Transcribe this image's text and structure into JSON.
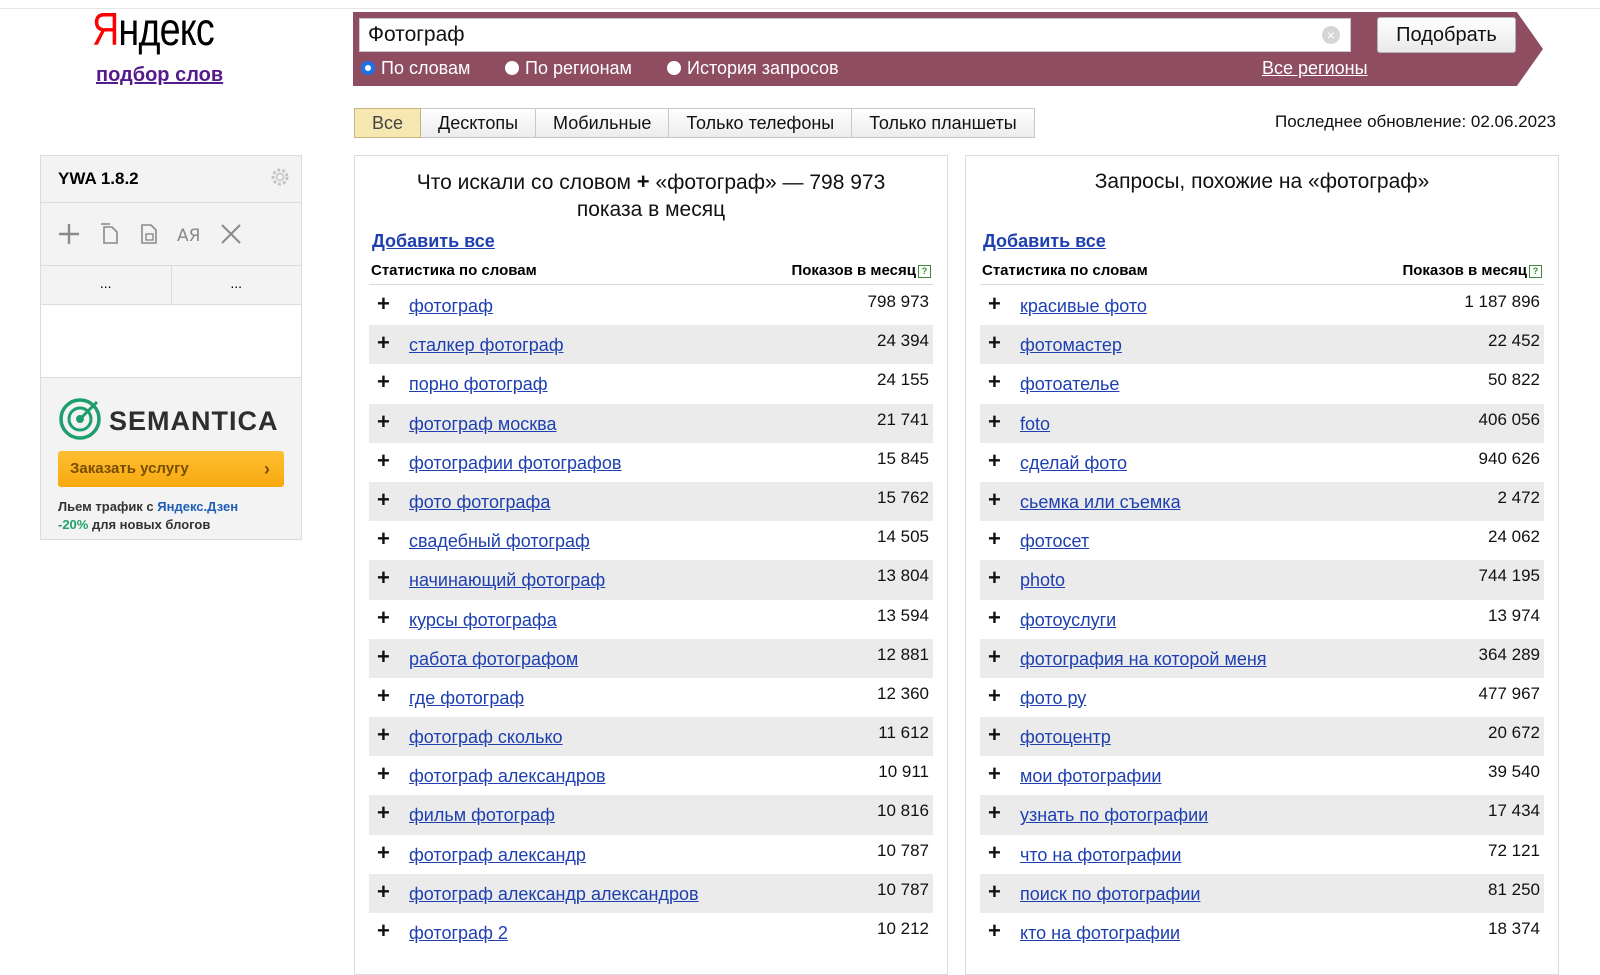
{
  "logo": {
    "first_letter": "Я",
    "rest": "ндекс",
    "subtitle": "подбор слов"
  },
  "search": {
    "value": "Фотограф",
    "clear_icon": "×",
    "submit_label": "Подобрать",
    "modes": [
      {
        "label": "По словам",
        "checked": true
      },
      {
        "label": "По регионам",
        "checked": false
      },
      {
        "label": "История запросов",
        "checked": false
      }
    ],
    "regions_link": "Все регионы"
  },
  "tabs": [
    {
      "label": "Все",
      "active": true
    },
    {
      "label": "Десктопы",
      "active": false
    },
    {
      "label": "Мобильные",
      "active": false
    },
    {
      "label": "Только телефоны",
      "active": false
    },
    {
      "label": "Только планшеты",
      "active": false
    }
  ],
  "last_update": "Последнее обновление: 02.06.2023",
  "widget": {
    "title": "YWA 1.8.2",
    "col1": "...",
    "col2": "...",
    "icons": [
      "plus-icon",
      "copy-icon",
      "export-icon",
      "case-icon",
      "close-icon"
    ]
  },
  "semantica": {
    "brand": "SEMANTICA",
    "order_label": "Заказать услугу",
    "order_arrow": "›",
    "promo_line1_a": "Льем трафик с ",
    "promo_line1_b": "Яндекс.Дзен",
    "promo_line2_a": "-20%",
    "promo_line2_b": " для новых блогов"
  },
  "left_panel": {
    "title_a": "Что искали со словом ",
    "title_plus": "+",
    "title_b": " «фотограф» — 798 973",
    "title_c": "показа в месяц",
    "add_all": "Добавить все",
    "col_words": "Статистика по словам",
    "col_count": "Показов в месяц",
    "help": "?",
    "rows": [
      {
        "kw": "фотограф",
        "count": "798 973"
      },
      {
        "kw": "сталкер фотограф",
        "count": "24 394"
      },
      {
        "kw": "порно фотограф",
        "count": "24 155"
      },
      {
        "kw": "фотограф москва",
        "count": "21 741"
      },
      {
        "kw": "фотографии фотографов",
        "count": "15 845"
      },
      {
        "kw": "фото фотографа",
        "count": "15 762"
      },
      {
        "kw": "свадебный фотограф",
        "count": "14 505"
      },
      {
        "kw": "начинающий фотограф",
        "count": "13 804"
      },
      {
        "kw": "курсы фотографа",
        "count": "13 594"
      },
      {
        "kw": "работа фотографом",
        "count": "12 881"
      },
      {
        "kw": "где фотограф",
        "count": "12 360"
      },
      {
        "kw": "фотограф сколько",
        "count": "11 612"
      },
      {
        "kw": "фотограф александров",
        "count": "10 911"
      },
      {
        "kw": "фильм фотограф",
        "count": "10 816"
      },
      {
        "kw": "фотограф александр",
        "count": "10 787"
      },
      {
        "kw": "фотограф александр александров",
        "count": "10 787"
      },
      {
        "kw": "фотограф 2",
        "count": "10 212"
      }
    ]
  },
  "right_panel": {
    "title": "Запросы, похожие на «фотограф»",
    "add_all": "Добавить все",
    "col_words": "Статистика по словам",
    "col_count": "Показов в месяц",
    "help": "?",
    "rows": [
      {
        "kw": "красивые фото",
        "count": "1 187 896"
      },
      {
        "kw": "фотомастер",
        "count": "22 452"
      },
      {
        "kw": "фотоателье",
        "count": "50 822"
      },
      {
        "kw": "foto",
        "count": "406 056"
      },
      {
        "kw": "сделай фото",
        "count": "940 626"
      },
      {
        "kw": "сьемка или съемка",
        "count": "2 472"
      },
      {
        "kw": "фотосет",
        "count": "24 062"
      },
      {
        "kw": "photo",
        "count": "744 195"
      },
      {
        "kw": "фотоуслуги",
        "count": "13 974"
      },
      {
        "kw": "фотография на которой меня",
        "count": "364 289"
      },
      {
        "kw": "фото ру",
        "count": "477 967"
      },
      {
        "kw": "фотоцентр",
        "count": "20 672"
      },
      {
        "kw": "мои фотографии",
        "count": "39 540"
      },
      {
        "kw": "узнать по фотографии",
        "count": "17 434"
      },
      {
        "kw": "что на фотографии",
        "count": "72 121"
      },
      {
        "kw": "поиск по фотографии",
        "count": "81 250"
      },
      {
        "kw": "кто на фотографии",
        "count": "18 374"
      }
    ]
  },
  "row_plus": "+",
  "colors": {
    "band": "#8e4d60",
    "link": "#1d3fb0",
    "logo_red": "#ff0000",
    "active_tab": "#f6e7b3"
  }
}
